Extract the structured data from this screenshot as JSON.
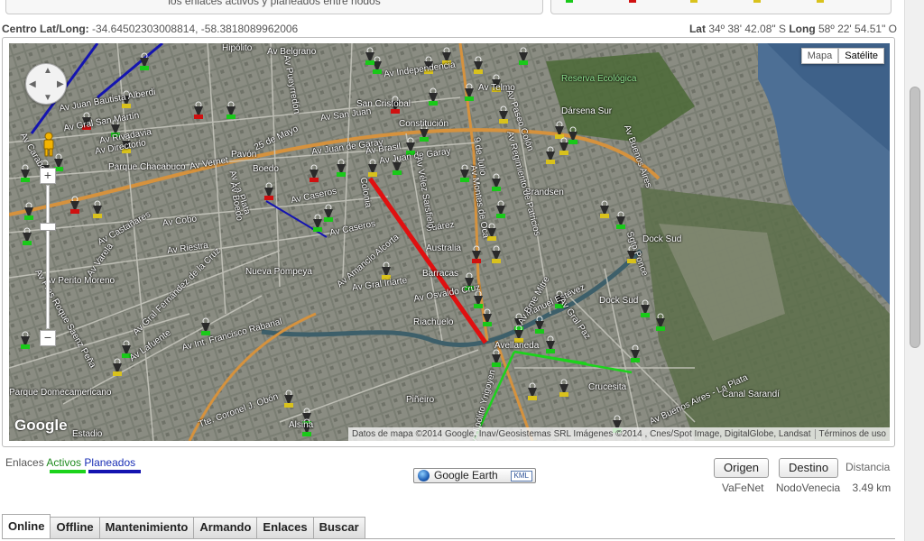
{
  "top": {
    "panel_text": "los enlaces activos y planeados entre nodos"
  },
  "coords": {
    "center_label": "Centro Lat/Long:",
    "center_value": "-34.64502303008814, -58.3818089962006",
    "lat_label": "Lat",
    "lat_value": "34º 38' 42.08\" S",
    "long_label": "Long",
    "long_value": "58º 22' 54.51\" O"
  },
  "map": {
    "type_buttons": [
      "Mapa",
      "Satélite"
    ],
    "active_type": "Satélite",
    "logo": "Google",
    "attribution": "Datos de mapa ©2014 Google, Inav/Geosistemas SRL Imágenes ©2014 , Cnes/Spot Image, DigitalGlobe, Landsat",
    "terms": "Términos de uso",
    "labels": [
      "Hipólito",
      "Av Belgrano",
      "Av Independencia",
      "Av Juan Bautista Alberdi",
      "Av Gral San Martín",
      "Av Rivadavia",
      "Av Directorio",
      "25 de Mayo",
      "Av San Juan",
      "San Cristobal",
      "Av Juan de Garay",
      "Constitución",
      "Av Brasil",
      "Av Vernet",
      "Pavón",
      "Boedo",
      "Av Caseros",
      "Parque Chacabuco",
      "Av Cobo",
      "Av Riestra",
      "Av Castañares",
      "Av Perito Moreno",
      "Nueva Pompeya",
      "Av Gral Iriarte",
      "Australia",
      "Barracas",
      "Suárez",
      "Av Amancio Alcorta",
      "Brandsen",
      "Av Regimiento de Patricios",
      "Av Osvaldo Cruz",
      "Riachuelo",
      "Manuel Estévez",
      "Av Gral Paz",
      "Dock Sud",
      "Sgto Ponce",
      "Dock Sud",
      "Av Lafuente",
      "Av Int. Francisco Rabanal",
      "Avellaneda",
      "Crucesita",
      "Av Bme Mitre",
      "Av Hipólito Yrigoyen",
      "Piñeiro",
      "Alsina",
      "Av Pres Roque Saenz Peña",
      "Tte. Coronel J. Obón",
      "Estadio",
      "Canal Sarandí",
      "Reserva Ecológica",
      "Dársena Sur",
      "Av Paseo Colón",
      "Av Caseros",
      "Av Juan de Garay",
      "Av Buenos Aires",
      "Av Buenos Aires - La Plata",
      "Parque Domecamericano",
      "Av Gral Fernández de la Cruz",
      "Av Varela",
      "Av La Plata",
      "Av Boedo",
      "Colonia",
      "Av Vélez Sarsfield",
      "Av Montes de Oca",
      "9 de Julio",
      "Av Carabobo",
      "Av Telmo",
      "Av Pueyrredón"
    ],
    "link_colors": {
      "active": "#1cd31c",
      "planned": "#1414b0",
      "selected": "#e01010"
    }
  },
  "legend": {
    "prefix": "Enlaces",
    "active": "Activos",
    "planned": "Planeados"
  },
  "google_earth": {
    "label": "Google Earth",
    "badge": "KML"
  },
  "distance": {
    "origin_button": "Origen",
    "destination_button": "Destino",
    "label": "Distancia",
    "origin_node": "VaFeNet",
    "destination_node": "NodoVenecia",
    "value": "3.49 km"
  },
  "tabs": [
    "Online",
    "Offline",
    "Mantenimiento",
    "Armando",
    "Enlaces",
    "Buscar"
  ],
  "active_tab": "Online"
}
